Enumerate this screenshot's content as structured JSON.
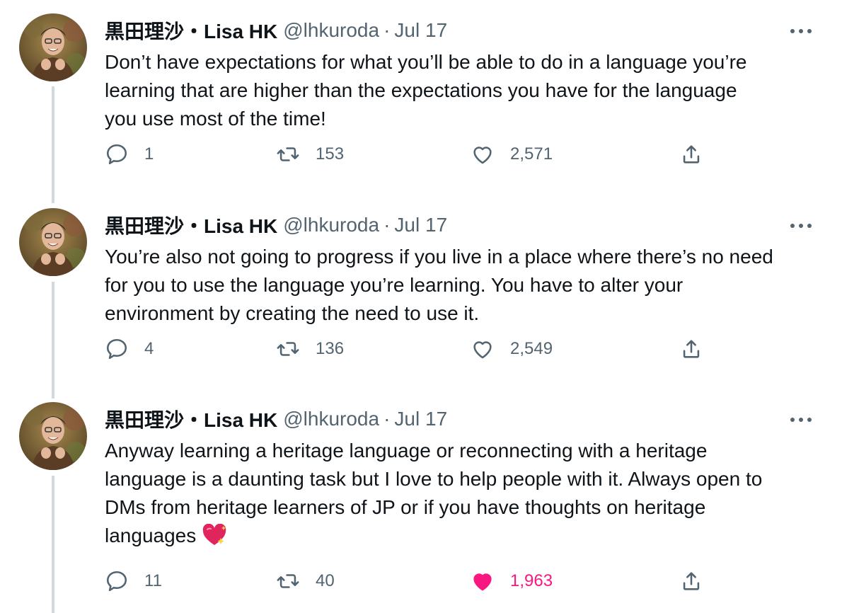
{
  "colors": {
    "text": "#0f1419",
    "secondary": "#536471",
    "thread_line": "#cfd9de",
    "like_active": "#f91880"
  },
  "tweets": [
    {
      "name": "黒田理沙・Lisa HK",
      "handle": "@lhkuroda",
      "separator": "·",
      "date": "Jul 17",
      "text": "Don’t have expectations for what you’ll be able to do in a language you’re\nlearning that are higher than the expectations you have for the language\nyou use most of the time!",
      "replies": "1",
      "retweets": "153",
      "likes": "2,571",
      "liked": false
    },
    {
      "name": "黒田理沙・Lisa HK",
      "handle": "@lhkuroda",
      "separator": "·",
      "date": "Jul 17",
      "text": "You’re also not going to progress if you live in a place where there’s no need\nfor you to use the language you’re learning. You have to alter your\nenvironment by creating the need to use it.",
      "replies": "4",
      "retweets": "136",
      "likes": "2,549",
      "liked": false
    },
    {
      "name": "黒田理沙・Lisa HK",
      "handle": "@lhkuroda",
      "separator": "·",
      "date": "Jul 17",
      "text": "Anyway learning a heritage language or reconnecting with a heritage\nlanguage is a daunting task but I love to help people with it. Always open to\nDMs from heritage learners of JP or if you have thoughts on heritage\nlanguages",
      "emoji": "sparkling-heart-icon",
      "replies": "11",
      "retweets": "40",
      "likes": "1,963",
      "liked": true
    }
  ],
  "icons": {
    "reply": "reply-icon",
    "retweet": "retweet-icon",
    "like": "heart-icon",
    "share": "share-icon",
    "more": "more-options-icon"
  }
}
